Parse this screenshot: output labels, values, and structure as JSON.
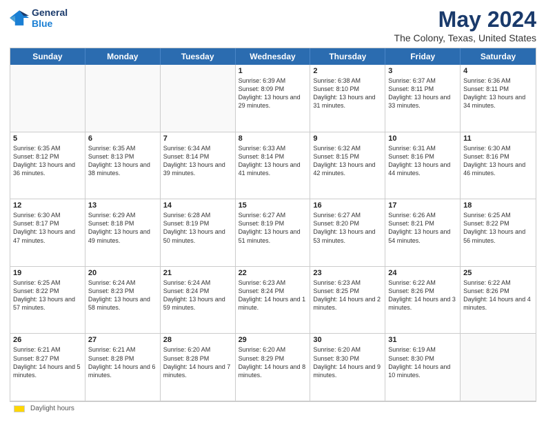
{
  "header": {
    "logo_line1": "General",
    "logo_line2": "Blue",
    "title": "May 2024",
    "subtitle": "The Colony, Texas, United States"
  },
  "calendar": {
    "days_of_week": [
      "Sunday",
      "Monday",
      "Tuesday",
      "Wednesday",
      "Thursday",
      "Friday",
      "Saturday"
    ],
    "rows": [
      {
        "cells": [
          {
            "day": "",
            "empty": true
          },
          {
            "day": "",
            "empty": true
          },
          {
            "day": "",
            "empty": true
          },
          {
            "day": "1",
            "sunrise": "Sunrise: 6:39 AM",
            "sunset": "Sunset: 8:09 PM",
            "daylight": "Daylight: 13 hours and 29 minutes."
          },
          {
            "day": "2",
            "sunrise": "Sunrise: 6:38 AM",
            "sunset": "Sunset: 8:10 PM",
            "daylight": "Daylight: 13 hours and 31 minutes."
          },
          {
            "day": "3",
            "sunrise": "Sunrise: 6:37 AM",
            "sunset": "Sunset: 8:11 PM",
            "daylight": "Daylight: 13 hours and 33 minutes."
          },
          {
            "day": "4",
            "sunrise": "Sunrise: 6:36 AM",
            "sunset": "Sunset: 8:11 PM",
            "daylight": "Daylight: 13 hours and 34 minutes."
          }
        ]
      },
      {
        "cells": [
          {
            "day": "5",
            "sunrise": "Sunrise: 6:35 AM",
            "sunset": "Sunset: 8:12 PM",
            "daylight": "Daylight: 13 hours and 36 minutes."
          },
          {
            "day": "6",
            "sunrise": "Sunrise: 6:35 AM",
            "sunset": "Sunset: 8:13 PM",
            "daylight": "Daylight: 13 hours and 38 minutes."
          },
          {
            "day": "7",
            "sunrise": "Sunrise: 6:34 AM",
            "sunset": "Sunset: 8:14 PM",
            "daylight": "Daylight: 13 hours and 39 minutes."
          },
          {
            "day": "8",
            "sunrise": "Sunrise: 6:33 AM",
            "sunset": "Sunset: 8:14 PM",
            "daylight": "Daylight: 13 hours and 41 minutes."
          },
          {
            "day": "9",
            "sunrise": "Sunrise: 6:32 AM",
            "sunset": "Sunset: 8:15 PM",
            "daylight": "Daylight: 13 hours and 42 minutes."
          },
          {
            "day": "10",
            "sunrise": "Sunrise: 6:31 AM",
            "sunset": "Sunset: 8:16 PM",
            "daylight": "Daylight: 13 hours and 44 minutes."
          },
          {
            "day": "11",
            "sunrise": "Sunrise: 6:30 AM",
            "sunset": "Sunset: 8:16 PM",
            "daylight": "Daylight: 13 hours and 46 minutes."
          }
        ]
      },
      {
        "cells": [
          {
            "day": "12",
            "sunrise": "Sunrise: 6:30 AM",
            "sunset": "Sunset: 8:17 PM",
            "daylight": "Daylight: 13 hours and 47 minutes."
          },
          {
            "day": "13",
            "sunrise": "Sunrise: 6:29 AM",
            "sunset": "Sunset: 8:18 PM",
            "daylight": "Daylight: 13 hours and 49 minutes."
          },
          {
            "day": "14",
            "sunrise": "Sunrise: 6:28 AM",
            "sunset": "Sunset: 8:19 PM",
            "daylight": "Daylight: 13 hours and 50 minutes."
          },
          {
            "day": "15",
            "sunrise": "Sunrise: 6:27 AM",
            "sunset": "Sunset: 8:19 PM",
            "daylight": "Daylight: 13 hours and 51 minutes."
          },
          {
            "day": "16",
            "sunrise": "Sunrise: 6:27 AM",
            "sunset": "Sunset: 8:20 PM",
            "daylight": "Daylight: 13 hours and 53 minutes."
          },
          {
            "day": "17",
            "sunrise": "Sunrise: 6:26 AM",
            "sunset": "Sunset: 8:21 PM",
            "daylight": "Daylight: 13 hours and 54 minutes."
          },
          {
            "day": "18",
            "sunrise": "Sunrise: 6:25 AM",
            "sunset": "Sunset: 8:22 PM",
            "daylight": "Daylight: 13 hours and 56 minutes."
          }
        ]
      },
      {
        "cells": [
          {
            "day": "19",
            "sunrise": "Sunrise: 6:25 AM",
            "sunset": "Sunset: 8:22 PM",
            "daylight": "Daylight: 13 hours and 57 minutes."
          },
          {
            "day": "20",
            "sunrise": "Sunrise: 6:24 AM",
            "sunset": "Sunset: 8:23 PM",
            "daylight": "Daylight: 13 hours and 58 minutes."
          },
          {
            "day": "21",
            "sunrise": "Sunrise: 6:24 AM",
            "sunset": "Sunset: 8:24 PM",
            "daylight": "Daylight: 13 hours and 59 minutes."
          },
          {
            "day": "22",
            "sunrise": "Sunrise: 6:23 AM",
            "sunset": "Sunset: 8:24 PM",
            "daylight": "Daylight: 14 hours and 1 minute."
          },
          {
            "day": "23",
            "sunrise": "Sunrise: 6:23 AM",
            "sunset": "Sunset: 8:25 PM",
            "daylight": "Daylight: 14 hours and 2 minutes."
          },
          {
            "day": "24",
            "sunrise": "Sunrise: 6:22 AM",
            "sunset": "Sunset: 8:26 PM",
            "daylight": "Daylight: 14 hours and 3 minutes."
          },
          {
            "day": "25",
            "sunrise": "Sunrise: 6:22 AM",
            "sunset": "Sunset: 8:26 PM",
            "daylight": "Daylight: 14 hours and 4 minutes."
          }
        ]
      },
      {
        "cells": [
          {
            "day": "26",
            "sunrise": "Sunrise: 6:21 AM",
            "sunset": "Sunset: 8:27 PM",
            "daylight": "Daylight: 14 hours and 5 minutes."
          },
          {
            "day": "27",
            "sunrise": "Sunrise: 6:21 AM",
            "sunset": "Sunset: 8:28 PM",
            "daylight": "Daylight: 14 hours and 6 minutes."
          },
          {
            "day": "28",
            "sunrise": "Sunrise: 6:20 AM",
            "sunset": "Sunset: 8:28 PM",
            "daylight": "Daylight: 14 hours and 7 minutes."
          },
          {
            "day": "29",
            "sunrise": "Sunrise: 6:20 AM",
            "sunset": "Sunset: 8:29 PM",
            "daylight": "Daylight: 14 hours and 8 minutes."
          },
          {
            "day": "30",
            "sunrise": "Sunrise: 6:20 AM",
            "sunset": "Sunset: 8:30 PM",
            "daylight": "Daylight: 14 hours and 9 minutes."
          },
          {
            "day": "31",
            "sunrise": "Sunrise: 6:19 AM",
            "sunset": "Sunset: 8:30 PM",
            "daylight": "Daylight: 14 hours and 10 minutes."
          },
          {
            "day": "",
            "empty": true
          }
        ]
      }
    ]
  },
  "footer": {
    "swatch_label": "Daylight hours"
  }
}
